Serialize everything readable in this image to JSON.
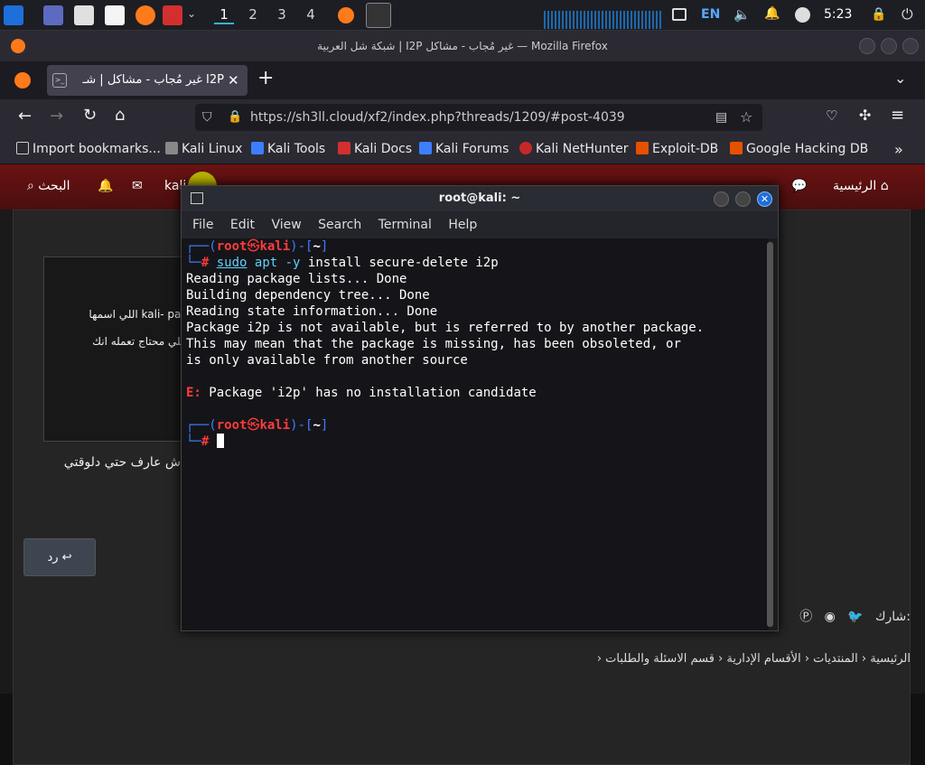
{
  "taskbar": {
    "workspaces": [
      "1",
      "2",
      "3",
      "4"
    ],
    "lang": "EN",
    "time": "5:23"
  },
  "firefox": {
    "window_title": "شبكة شل العربية | I2P غير مُجاب - مشاكل — Mozilla Firefox",
    "tab_title": "I2P غير مُجاب - مشاكل | شـ",
    "url": "https://sh3ll.cloud/xf2/index.php?threads/1209/#post-4039",
    "bookmarks": [
      "Import bookmarks...",
      "Kali Linux",
      "Kali Tools",
      "Kali Docs",
      "Kali Forums",
      "Kali NetHunter",
      "Exploit-DB",
      "Google Hacking DB"
    ]
  },
  "forum": {
    "nav_home": "الرئيسية",
    "nav_search": "البحث",
    "nav_user": "kali",
    "quote_line1": "kali- pac اللي اسمها",
    "quote_line2": "اللي محتاج تعمله انك",
    "post_line": "ش عارف حتي دلوقتي",
    "reply_label": "رد",
    "share_label": "شارك:",
    "breadcrumb": [
      "الرئيسية",
      "المنتديات",
      "الأقسام الإدارية",
      "قسم الاسئلة والطلبات"
    ]
  },
  "terminal": {
    "title": "root@kali: ~",
    "menu": [
      "File",
      "Edit",
      "View",
      "Search",
      "Terminal",
      "Help"
    ],
    "prompt_user": "root",
    "prompt_at": "㉿",
    "prompt_host": "kali",
    "prompt_dir": "~",
    "cmd_sudo": "sudo",
    "cmd_apt": "apt",
    "cmd_flag": "-y",
    "cmd_rest": "install secure-delete i2p",
    "out1": "Reading package lists... Done",
    "out2": "Building dependency tree... Done",
    "out3": "Reading state information... Done",
    "out4": "Package i2p is not available, but is referred to by another package.",
    "out5": "This may mean that the package is missing, has been obsoleted, or",
    "out6": "is only available from another source",
    "err_prefix": "E:",
    "err_msg": "Package 'i2p' has no installation candidate"
  }
}
